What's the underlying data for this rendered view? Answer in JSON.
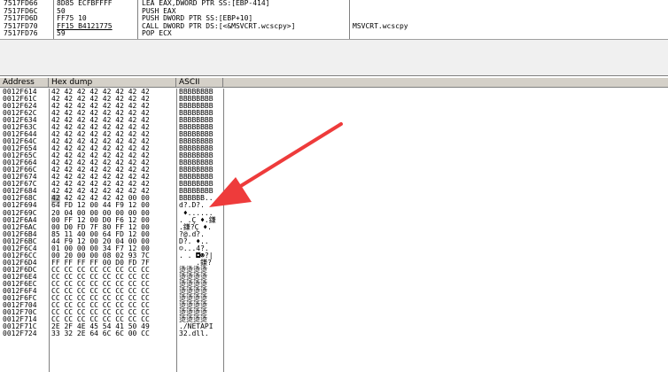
{
  "disassembly": [
    {
      "addr": "7517FD66",
      "hex": "8D85 ECFBFFFF",
      "asm": "LEA EAX,DWORD PTR SS:[EBP-414]",
      "comment": ""
    },
    {
      "addr": "7517FD6C",
      "hex": "50",
      "asm": "PUSH EAX",
      "comment": ""
    },
    {
      "addr": "7517FD6D",
      "hex": "FF75 10",
      "asm": "PUSH DWORD PTR SS:[EBP+10]",
      "comment": ""
    },
    {
      "addr": "7517FD70",
      "hex": "FF15 B4121775",
      "asm": "CALL DWORD PTR DS:[<&MSVCRT.wcscpy>]",
      "comment": "MSVCRT.wcscpy"
    },
    {
      "addr": "7517FD76",
      "hex": "59",
      "asm": "POP ECX",
      "comment": ""
    }
  ],
  "dump": {
    "headers": {
      "address": "Address",
      "hex": "Hex dump",
      "ascii": "ASCII"
    },
    "selected_byte": {
      "row": 15,
      "text": "42"
    },
    "rows": [
      {
        "addr": "0012F614",
        "hex": "42 42 42 42 42 42 42 42",
        "ascii": "BBBBBBBB"
      },
      {
        "addr": "0012F61C",
        "hex": "42 42 42 42 42 42 42 42",
        "ascii": "BBBBBBBB"
      },
      {
        "addr": "0012F624",
        "hex": "42 42 42 42 42 42 42 42",
        "ascii": "BBBBBBBB"
      },
      {
        "addr": "0012F62C",
        "hex": "42 42 42 42 42 42 42 42",
        "ascii": "BBBBBBBB"
      },
      {
        "addr": "0012F634",
        "hex": "42 42 42 42 42 42 42 42",
        "ascii": "BBBBBBBB"
      },
      {
        "addr": "0012F63C",
        "hex": "42 42 42 42 42 42 42 42",
        "ascii": "BBBBBBBB"
      },
      {
        "addr": "0012F644",
        "hex": "42 42 42 42 42 42 42 42",
        "ascii": "BBBBBBBB"
      },
      {
        "addr": "0012F64C",
        "hex": "42 42 42 42 42 42 42 42",
        "ascii": "BBBBBBBB"
      },
      {
        "addr": "0012F654",
        "hex": "42 42 42 42 42 42 42 42",
        "ascii": "BBBBBBBB"
      },
      {
        "addr": "0012F65C",
        "hex": "42 42 42 42 42 42 42 42",
        "ascii": "BBBBBBBB"
      },
      {
        "addr": "0012F664",
        "hex": "42 42 42 42 42 42 42 42",
        "ascii": "BBBBBBBB"
      },
      {
        "addr": "0012F66C",
        "hex": "42 42 42 42 42 42 42 42",
        "ascii": "BBBBBBBB"
      },
      {
        "addr": "0012F674",
        "hex": "42 42 42 42 42 42 42 42",
        "ascii": "BBBBBBBB"
      },
      {
        "addr": "0012F67C",
        "hex": "42 42 42 42 42 42 42 42",
        "ascii": "BBBBBBBB"
      },
      {
        "addr": "0012F684",
        "hex": "42 42 42 42 42 42 42 42",
        "ascii": "BBBBBBBB"
      },
      {
        "addr": "0012F68C",
        "hex": "   42 42 42 42 42 00 00",
        "ascii": "BBBBBB.."
      },
      {
        "addr": "0012F694",
        "hex": "64 FD 12 00 44 F9 12 00",
        "ascii": "d?.D?."
      },
      {
        "addr": "0012F69C",
        "hex": "20 04 00 00 00 00 00 00",
        "ascii": " ♦......"
      },
      {
        "addr": "0012F6A4",
        "hex": "00 FF 12 00 D0 F6 12 00",
        "ascii": ". .Ç ♦.鎌"
      },
      {
        "addr": "0012F6AC",
        "hex": "00 D0 FD 7F 80 FF 12 00",
        "ascii": ".鎌?Ç ♦."
      },
      {
        "addr": "0012F6B4",
        "hex": "85 11 40 00 64 FD 12 00",
        "ascii": "?@.d?."
      },
      {
        "addr": "0012F6BC",
        "hex": "44 F9 12 00 20 04 00 00",
        "ascii": "D?. ♦.."
      },
      {
        "addr": "0012F6C4",
        "hex": "01 00 00 00 34 F7 12 00",
        "ascii": "☺...4?."
      },
      {
        "addr": "0012F6CC",
        "hex": "00 20 00 00 08 02 93 7C",
        "ascii": ". . ◘☻?|"
      },
      {
        "addr": "0012F6D4",
        "hex": "FF FF FF FF 00 D0 FD 7F",
        "ascii": "    .鎌?"
      },
      {
        "addr": "0012F6DC",
        "hex": "CC CC CC CC CC CC CC CC",
        "ascii": "烫烫烫烫"
      },
      {
        "addr": "0012F6E4",
        "hex": "CC CC CC CC CC CC CC CC",
        "ascii": "烫烫烫烫"
      },
      {
        "addr": "0012F6EC",
        "hex": "CC CC CC CC CC CC CC CC",
        "ascii": "烫烫烫烫"
      },
      {
        "addr": "0012F6F4",
        "hex": "CC CC CC CC CC CC CC CC",
        "ascii": "烫烫烫烫"
      },
      {
        "addr": "0012F6FC",
        "hex": "CC CC CC CC CC CC CC CC",
        "ascii": "烫烫烫烫"
      },
      {
        "addr": "0012F704",
        "hex": "CC CC CC CC CC CC CC CC",
        "ascii": "烫烫烫烫"
      },
      {
        "addr": "0012F70C",
        "hex": "CC CC CC CC CC CC CC CC",
        "ascii": "烫烫烫烫"
      },
      {
        "addr": "0012F714",
        "hex": "CC CC CC CC CC CC CC CC",
        "ascii": "烫烫烫烫"
      },
      {
        "addr": "0012F71C",
        "hex": "2E 2F 4E 45 54 41 50 49",
        "ascii": "./NETAPI"
      },
      {
        "addr": "0012F724",
        "hex": "33 32 2E 64 6C 6C 00 CC",
        "ascii": "32.dll."
      }
    ]
  },
  "colors": {
    "arrow": "#ee3b3b",
    "header_bg": "#d4d0c8",
    "selection": "#c0c0c0"
  }
}
